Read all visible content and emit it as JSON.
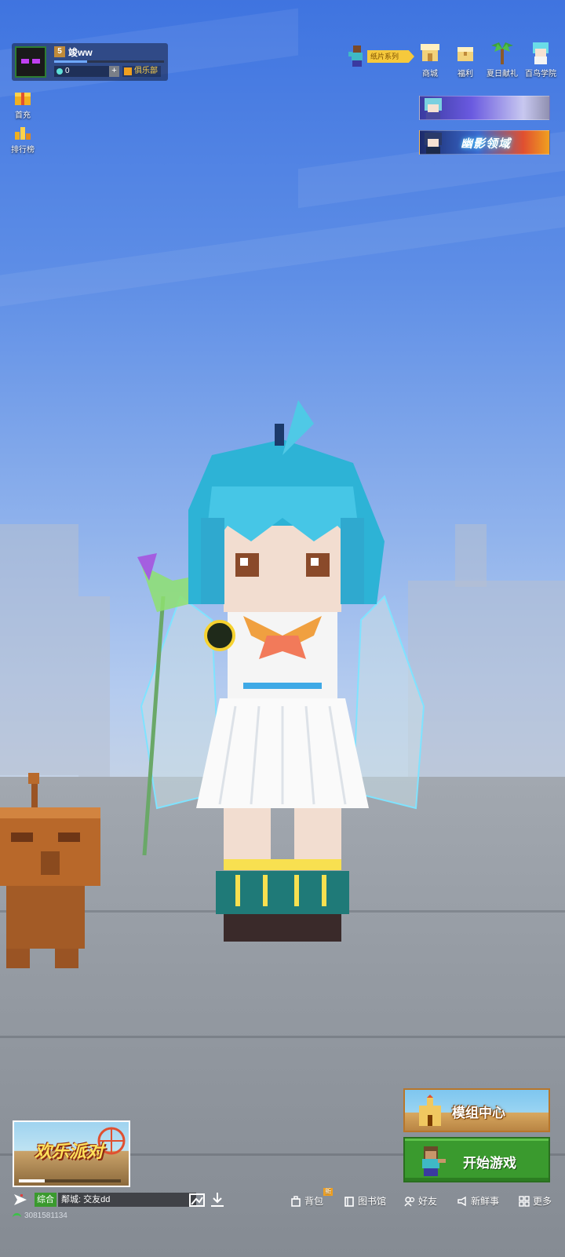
{
  "profile": {
    "level": "5",
    "username": "竣ww",
    "currency": "0",
    "add_label": "+",
    "club_label": "俱乐部",
    "xp_fraction": 0.3
  },
  "side_buttons": {
    "first_charge": "首充",
    "leaderboard": "排行榜"
  },
  "top_right": {
    "paper_series": "纸片系列",
    "shop": "商城",
    "welfare": "福利",
    "summer_gift": "夏日献礼",
    "bird_academy": "百鸟学院",
    "banner_2_text": "幽影领域"
  },
  "actions": {
    "mod_center": "模组中心",
    "start_game": "开始游戏"
  },
  "event": {
    "title": "欢乐派对",
    "progress_fraction": 0.25
  },
  "chat": {
    "channel_tag": "综合",
    "message": "鄰城: 交友dd"
  },
  "account_id": "3081581134",
  "bottom_nav": {
    "backpack": "背包",
    "backpack_badge": "新",
    "library": "图书馆",
    "friends": "好友",
    "news": "新鲜事",
    "more": "更多"
  },
  "colors": {
    "accent_green": "#3a9a2e",
    "club_gold": "#ffd24a",
    "sky_top": "#3f74e0"
  }
}
